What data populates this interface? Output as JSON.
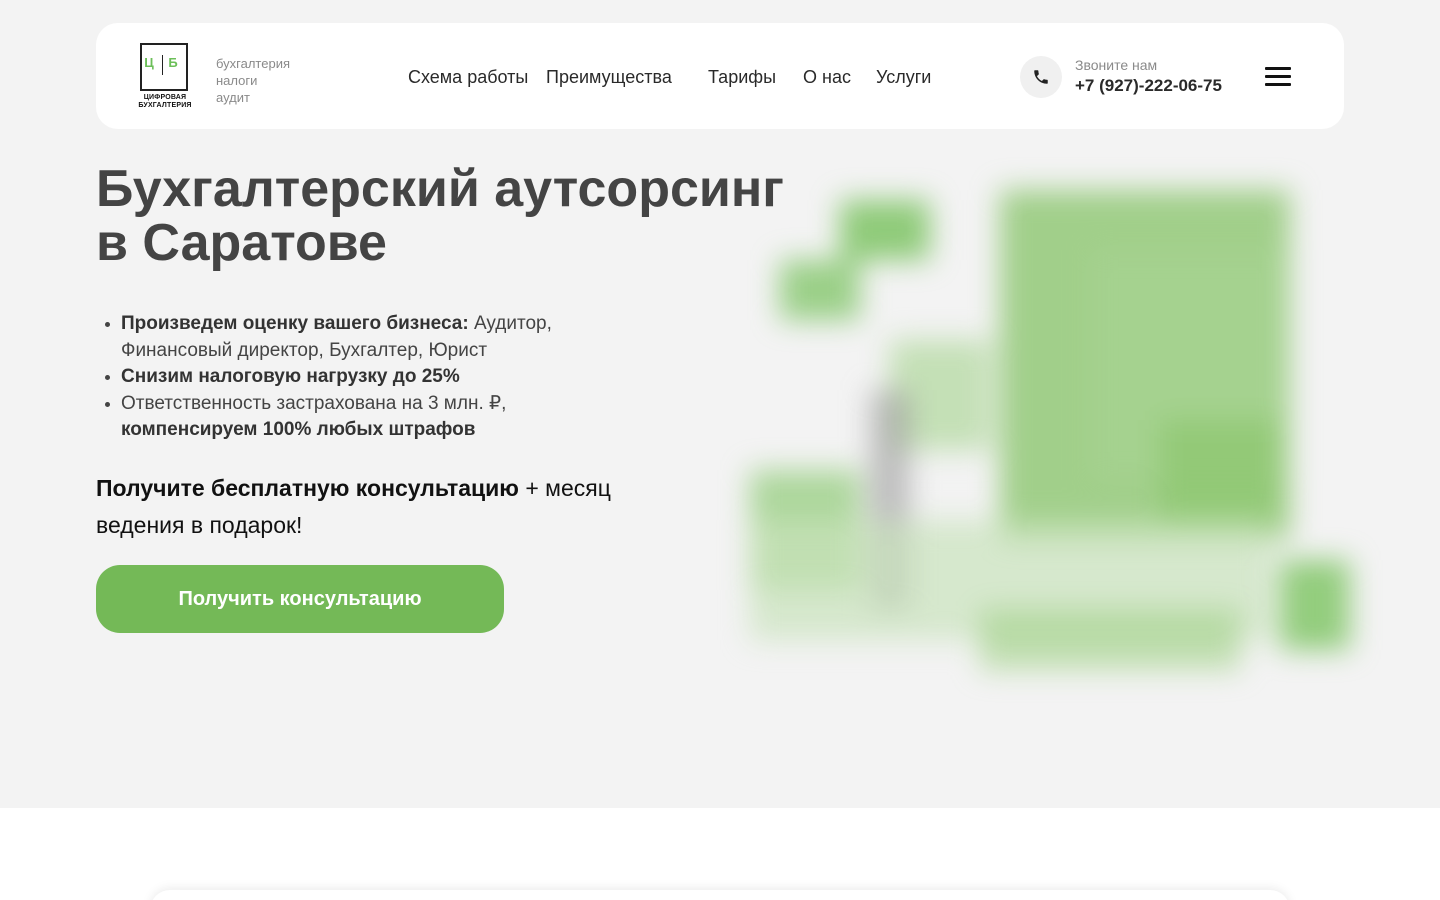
{
  "logo": {
    "letters": [
      "Ц",
      "Б"
    ],
    "caption_line1": "ЦИФРОВАЯ",
    "caption_line2": "БУХГАЛТЕРИЯ"
  },
  "tagline": [
    "бухгалтерия",
    "налоги",
    "аудит"
  ],
  "nav": [
    "Схема работы",
    "Преимущества",
    "Тарифы",
    "О нас",
    "Услуги"
  ],
  "contact": {
    "label": "Звоните нам",
    "phone": "+7 (927)-222-06-75"
  },
  "hero": {
    "title_line1": "Бухгалтерский аутсорсинг",
    "title_line2": "в Саратове",
    "benefits": [
      {
        "bold": "Произведем оценку вашего бизнеса:",
        "text": " Аудитор, Финансовый директор, Бухгалтер, Юрист"
      },
      {
        "bold": "Снизим налоговую нагрузку до 25%",
        "text": ""
      },
      {
        "text": "Ответственность застрахована на 3 млн. ₽,",
        "bold": "компенсируем 100% любых штрафов"
      }
    ],
    "offer_bold": "Получите бесплатную консультацию",
    "offer_rest": " + месяц ведения в подарок!",
    "cta": "Получить консультацию"
  },
  "colors": {
    "accent": "#74b957",
    "hero_background": "#f3f3f3",
    "text_dark": "#444444"
  },
  "icons": [
    "phone-icon",
    "hamburger-menu-icon"
  ]
}
